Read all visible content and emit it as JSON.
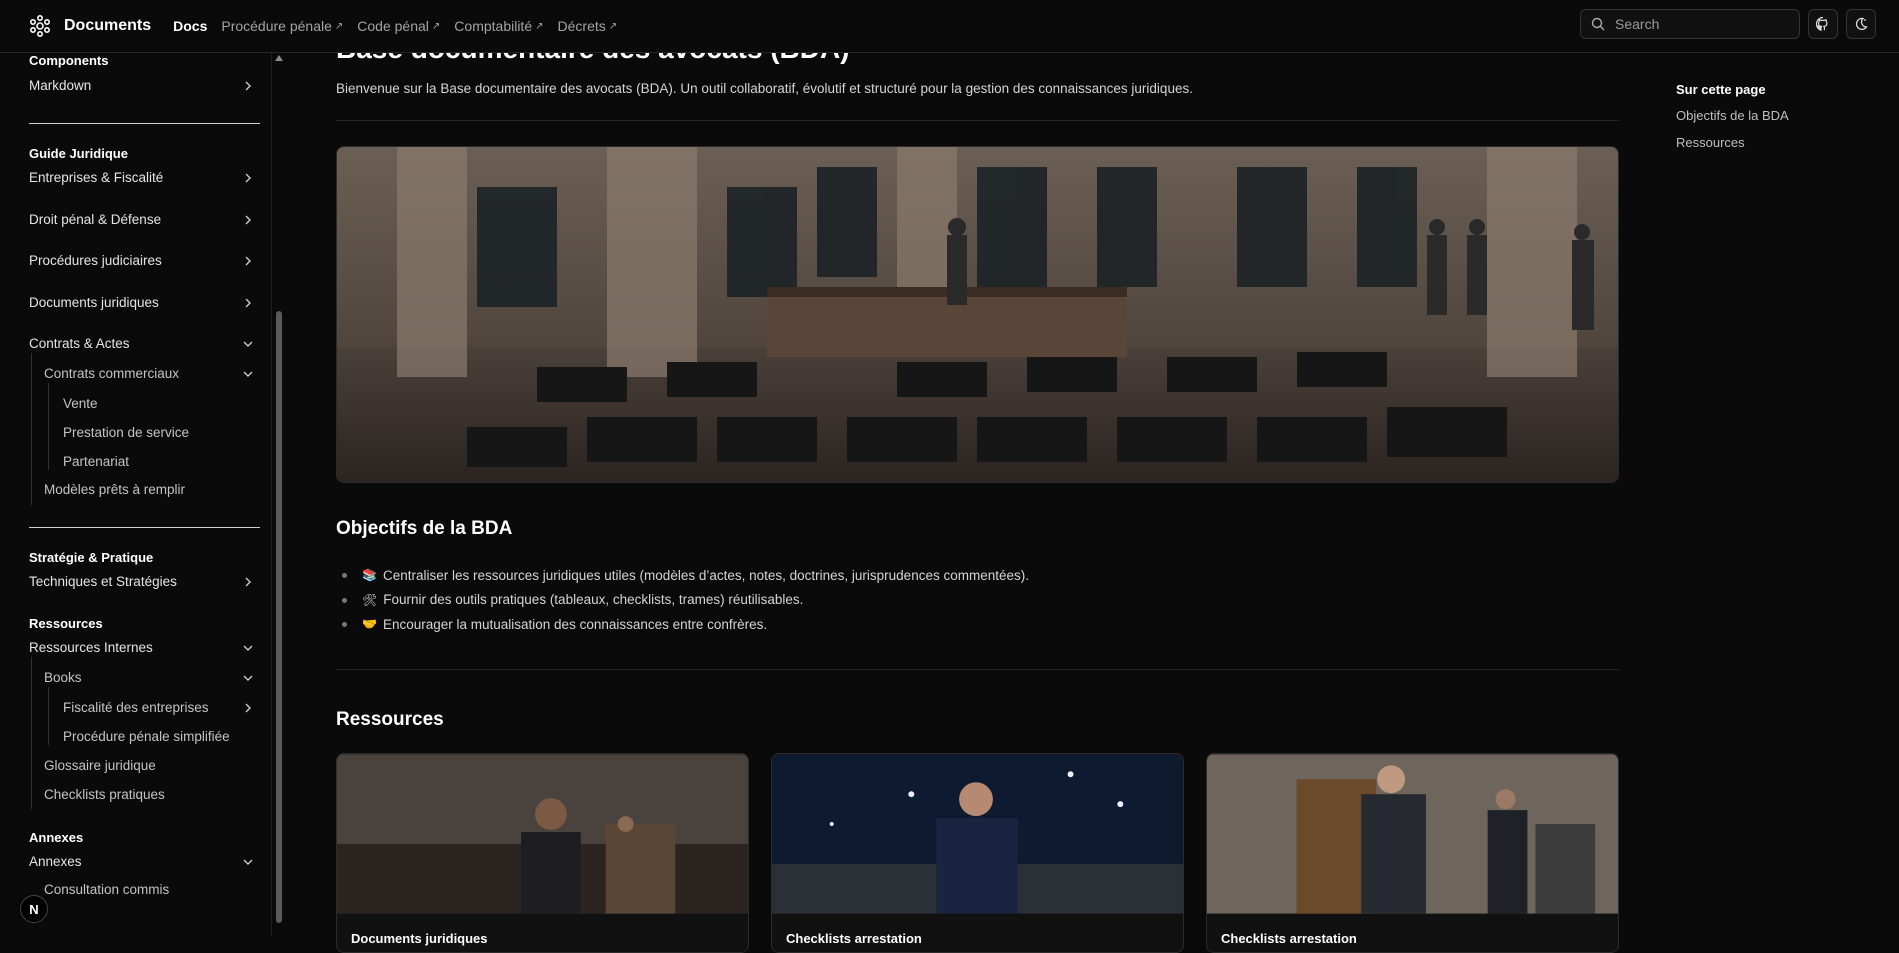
{
  "header": {
    "brand": "Documents",
    "nav": [
      {
        "label": "Docs",
        "external": false
      },
      {
        "label": "Procédure pénale",
        "external": true
      },
      {
        "label": "Code pénal",
        "external": true
      },
      {
        "label": "Comptabilité",
        "external": true
      },
      {
        "label": "Décrets",
        "external": true
      }
    ],
    "external_glyph": "↗",
    "search_placeholder": "Search",
    "github_icon": "github-icon",
    "theme_icon": "theme-toggle-icon"
  },
  "sidebar": {
    "components_heading": "Components",
    "markdown": "Markdown",
    "guide_heading": "Guide Juridique",
    "guide_items": [
      "Entreprises & Fiscalité",
      "Droit pénal & Défense",
      "Procédures judiciaires",
      "Documents juridiques"
    ],
    "contrats": "Contrats & Actes",
    "contrats_commerciaux": "Contrats commerciaux",
    "contrats_sub": [
      "Vente",
      "Prestation de service",
      "Partenariat"
    ],
    "modeles": "Modèles prêts à remplir",
    "strategie_heading": "Stratégie & Pratique",
    "techniques": "Techniques et Stratégies",
    "ressources_heading": "Ressources",
    "ressources_internes": "Ressources Internes",
    "books": "Books",
    "books_sub": [
      "Fiscalité des entreprises",
      "Procédure pénale simplifiée"
    ],
    "glossaire": "Glossaire juridique",
    "checklists": "Checklists pratiques",
    "annexes_heading": "Annexes",
    "annexes": "Annexes",
    "consultation": "Consultation commis",
    "badge": "N"
  },
  "main": {
    "title": "Base documentaire des avocats (BDA)",
    "intro": "Bienvenue sur la Base documentaire des avocats (BDA). Un outil collaboratif, évolutif et structuré pour la gestion des connaissances juridiques.",
    "objectifs_heading": "Objectifs de la BDA",
    "objectifs": [
      {
        "emoji": "📚",
        "text": "Centraliser les ressources juridiques utiles (modèles d’actes, notes, doctrines, jurisprudences commentées)."
      },
      {
        "emoji": "🛠",
        "text": "Fournir des outils pratiques (tableaux, checklists, trames) réutilisables."
      },
      {
        "emoji": "🤝",
        "text": "Encourager la mutualisation des connaissances entre confrères."
      }
    ],
    "ressources_heading": "Ressources",
    "cards": [
      {
        "title": "Documents juridiques"
      },
      {
        "title": "Checklists arrestation"
      },
      {
        "title": "Checklists arrestation"
      }
    ]
  },
  "toc": {
    "title": "Sur cette page",
    "links": [
      "Objectifs de la BDA",
      "Ressources"
    ]
  }
}
